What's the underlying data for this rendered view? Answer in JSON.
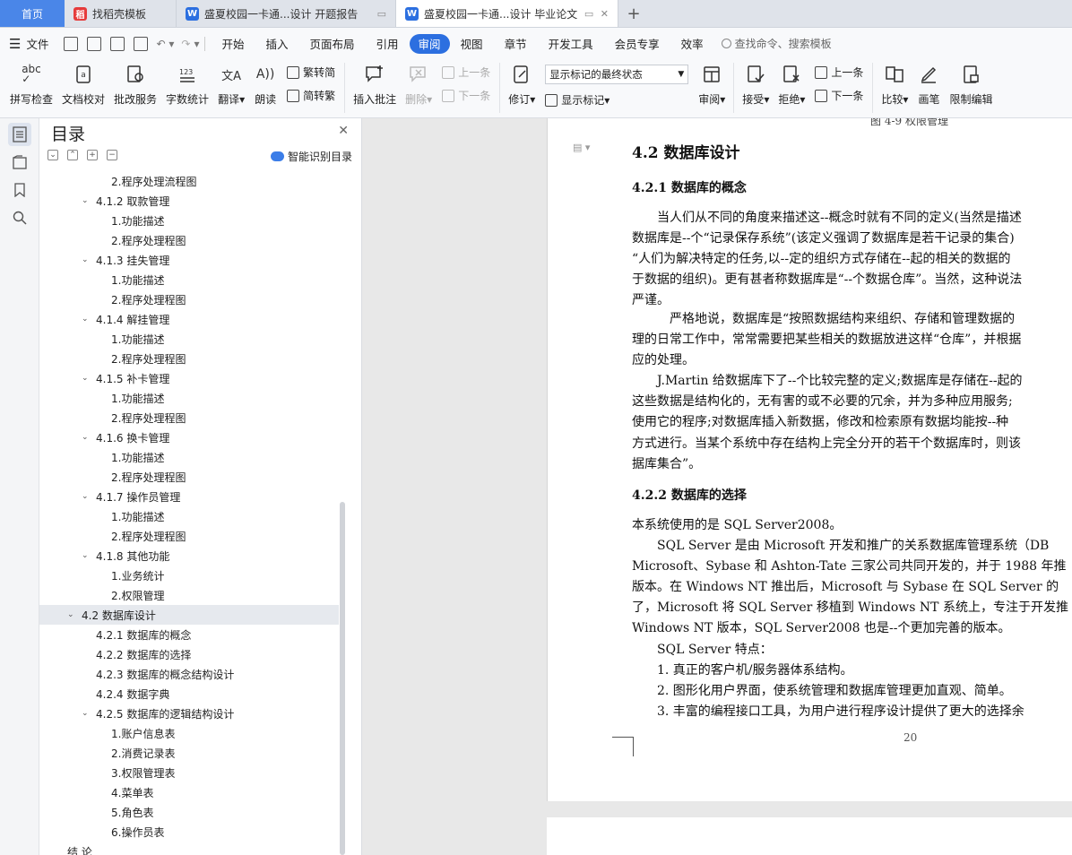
{
  "tabs": [
    {
      "label": "首页"
    },
    {
      "label": "找稻壳模板"
    },
    {
      "label": "盛夏校园一卡通...设计 开题报告"
    },
    {
      "label": "盛夏校园一卡通...设计 毕业论文"
    }
  ],
  "menu": {
    "file": "文件",
    "items": [
      "开始",
      "插入",
      "页面布局",
      "引用",
      "审阅",
      "视图",
      "章节",
      "开发工具",
      "会员专享",
      "效率"
    ],
    "active": "审阅",
    "search": "查找命令、搜索模板"
  },
  "ribbon": {
    "spell": "拼写检查",
    "proof": "文档校对",
    "annotate_service": "批改服务",
    "wordcount": "字数统计",
    "translate": "翻译",
    "read": "朗读",
    "trad": "繁转简",
    "simp": "简转繁",
    "insert_comment": "插入批注",
    "delete": "删除",
    "prev": "上一条",
    "next": "下一条",
    "revise": "修订",
    "markup_select": "显示标记的最终状态",
    "show_markup": "显示标记",
    "review": "审阅",
    "accept": "接受",
    "reject": "拒绝",
    "prev2": "上一条",
    "next2": "下一条",
    "compare": "比较",
    "pen": "画笔",
    "restrict": "限制编辑"
  },
  "toc": {
    "title": "目录",
    "smart": "智能识别目录",
    "items": [
      {
        "text": "2.程序处理流程图",
        "level": 3
      },
      {
        "text": "4.1.2  取款管理",
        "level": 2
      },
      {
        "text": "1.功能描述",
        "level": 3
      },
      {
        "text": "2.程序处理程图",
        "level": 3
      },
      {
        "text": "4.1.3  挂失管理",
        "level": 2
      },
      {
        "text": "1.功能描述",
        "level": 3
      },
      {
        "text": "2.程序处理程图",
        "level": 3
      },
      {
        "text": "4.1.4  解挂管理",
        "level": 2
      },
      {
        "text": "1.功能描述",
        "level": 3
      },
      {
        "text": "2.程序处理程图",
        "level": 3
      },
      {
        "text": "4.1.5  补卡管理",
        "level": 2
      },
      {
        "text": "1.功能描述",
        "level": 3
      },
      {
        "text": "2.程序处理程图",
        "level": 3
      },
      {
        "text": "4.1.6  换卡管理",
        "level": 2
      },
      {
        "text": "1.功能描述",
        "level": 3
      },
      {
        "text": "2.程序处理程图",
        "level": 3
      },
      {
        "text": "4.1.7  操作员管理",
        "level": 2
      },
      {
        "text": "1.功能描述",
        "level": 3
      },
      {
        "text": "2.程序处理程图",
        "level": 3
      },
      {
        "text": "4.1.8  其他功能",
        "level": 2
      },
      {
        "text": "1.业务统计",
        "level": 3
      },
      {
        "text": "2.权限管理",
        "level": 3
      },
      {
        "text": "4.2  数据库设计",
        "level": 1,
        "selected": true
      },
      {
        "text": "4.2.1  数据库的概念",
        "level": 2,
        "leaf": true
      },
      {
        "text": "4.2.2  数据库的选择",
        "level": 2,
        "leaf": true
      },
      {
        "text": "4.2.3  数据库的概念结构设计",
        "level": 2,
        "leaf": true
      },
      {
        "text": "4.2.4  数据字典",
        "level": 2,
        "leaf": true
      },
      {
        "text": "4.2.5  数据库的逻辑结构设计",
        "level": 2
      },
      {
        "text": "1.账户信息表",
        "level": 3
      },
      {
        "text": "2.消费记录表",
        "level": 3
      },
      {
        "text": "3.权限管理表",
        "level": 3
      },
      {
        "text": "4.菜单表",
        "level": 3
      },
      {
        "text": "5.角色表",
        "level": 3
      },
      {
        "text": "6.操作员表",
        "level": 3
      },
      {
        "text": "结    论",
        "level": 0
      }
    ]
  },
  "doc": {
    "caption_top": "图 4-9  权限管理",
    "h2": "4.2  数据库设计",
    "h3a": "4.2.1  数据库的概念",
    "p1": [
      "　　当人们从不同的角度来描述这--概念时就有不同的定义(当然是描述",
      "数据库是--个“记录保存系统”(该定义强调了数据库是若干记录的集合)",
      "“人们为解决特定的任务,以--定的组织方式存储在--起的相关的数据的",
      "于数据的组织)。更有甚者称数据库是“--个数据仓库”。当然，这种说法",
      "严谨。"
    ],
    "p2": [
      "　　　严格地说，数据库是“按照数据结构来组织、存储和管理数据的",
      "理的日常工作中，常常需要把某些相关的数据放进这样“仓库”，并根据",
      "应的处理。"
    ],
    "p3": [
      "　　J.Martin 给数据库下了--个比较完整的定义;数据库是存储在--起的",
      "这些数据是结构化的，无有害的或不必要的冗余，并为多种应用服务;",
      "使用它的程序;对数据库插入新数据，修改和检索原有数据均能按--种",
      "方式进行。当某个系统中存在结构上完全分开的若干个数据库时，则该",
      "据库集合”。"
    ],
    "h3b": "4.2.2  数据库的选择",
    "p4": "本系统使用的是 SQL Server2008。",
    "p5": [
      "　　SQL Server 是由 Microsoft 开发和推广的关系数据库管理系统（DB",
      "Microsoft、Sybase 和 Ashton-Tate 三家公司共同开发的，并于 1988 年推",
      "版本。在 Windows NT  推出后，Microsoft 与 Sybase  在 SQL Server  的",
      "了，Microsoft  将 SQL Server  移植到 Windows NT 系统上，专注于开发推",
      "Windows NT  版本，SQL Server2008 也是--个更加完善的版本。"
    ],
    "p6": "　　SQL Server  特点：",
    "list": [
      "　　1.  真正的客户机/服务器体系结构。",
      "　　2.  图形化用户界面，使系统管理和数据库管理更加直观、简单。",
      "　　3.  丰富的编程接口工具，为用户进行程序设计提供了更大的选择余"
    ],
    "page_number": "20"
  }
}
